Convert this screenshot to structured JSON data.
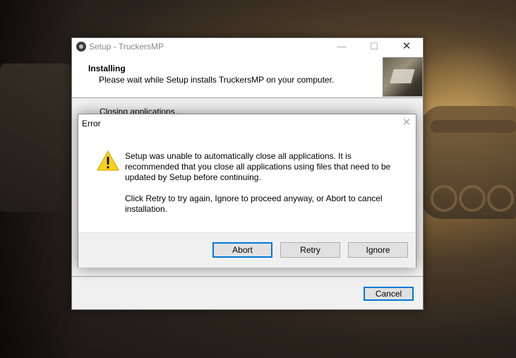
{
  "setup": {
    "title": "Setup - TruckersMP",
    "min_glyph": "—",
    "max_glyph": "☐",
    "close_glyph": "✕",
    "header_title": "Installing",
    "header_subtitle": "Please wait while Setup installs TruckersMP on your computer.",
    "status": "Closing applications...",
    "cancel_label": "Cancel"
  },
  "error_dialog": {
    "title": "Error",
    "close_glyph": "✕",
    "icon": "warning-icon",
    "message_1": "Setup was unable to automatically close all applications. It is recommended that you close all applications using files that need to be updated by Setup before continuing.",
    "message_2": "Click Retry to try again, Ignore to proceed anyway, or Abort to cancel installation.",
    "buttons": {
      "abort": "Abort",
      "retry": "Retry",
      "ignore": "Ignore"
    }
  },
  "colors": {
    "accent": "#0078d7",
    "warning_fill": "#fcd116"
  }
}
